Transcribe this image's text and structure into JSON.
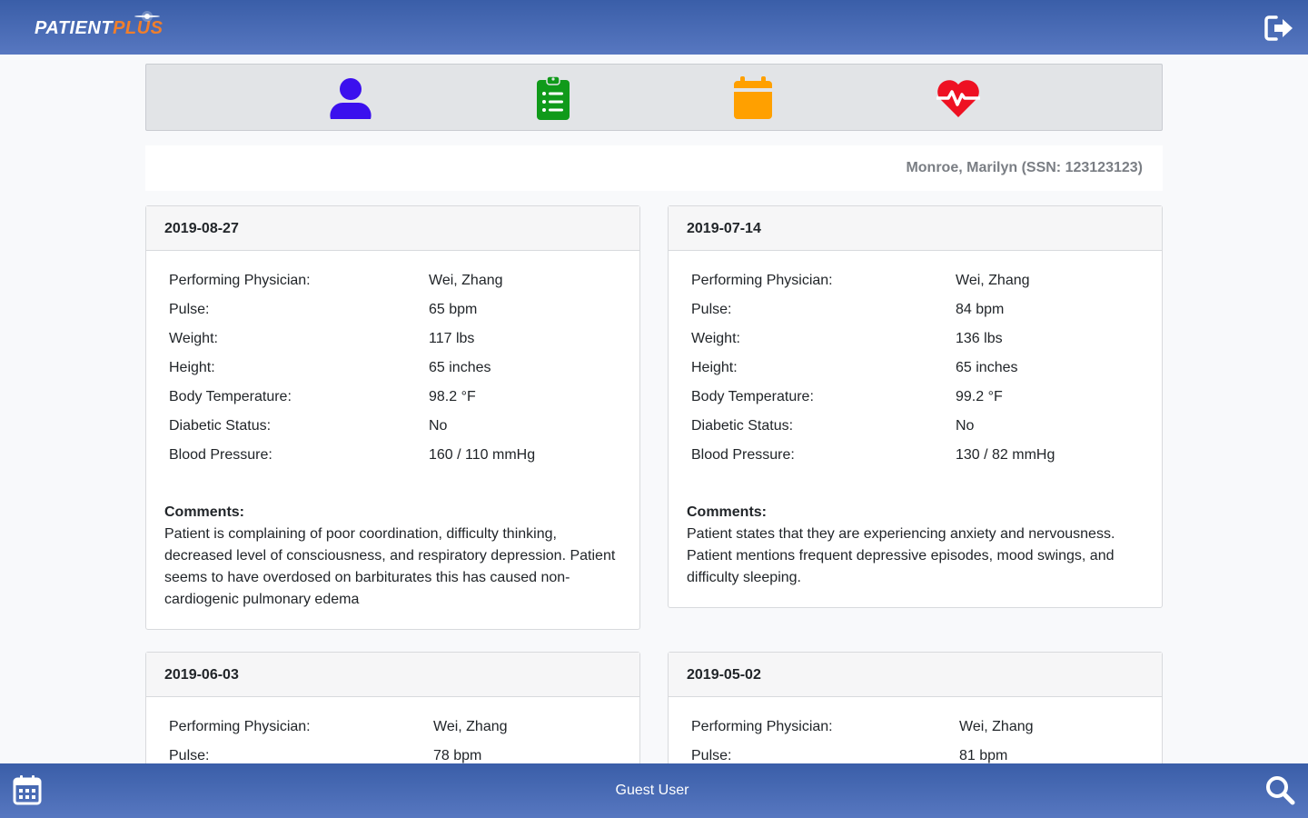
{
  "app": {
    "logo_part1": "PATIENT",
    "logo_part2": "PLUS",
    "brand_color": "#3a5ea8",
    "logo_accent": "#f07f2c"
  },
  "nav_icons": [
    {
      "icon": "user-icon",
      "color": "#3b10ee"
    },
    {
      "icon": "clipboard-list-icon",
      "color": "#109a1a"
    },
    {
      "icon": "calendar-icon",
      "color": "#ffa000"
    },
    {
      "icon": "heartbeat-icon",
      "color": "#ee1122"
    }
  ],
  "patient": {
    "display": "Monroe, Marilyn (SSN: 123123123)"
  },
  "labels": {
    "physician": "Performing Physician:",
    "pulse": "Pulse:",
    "weight": "Weight:",
    "height": "Height:",
    "temperature": "Body Temperature:",
    "diabetic": "Diabetic Status:",
    "bp": "Blood Pressure:",
    "comments": "Comments:"
  },
  "visits": [
    {
      "date": "2019-08-27",
      "physician": "Wei, Zhang",
      "pulse": "65 bpm",
      "weight": "117 lbs",
      "height": "65 inches",
      "temperature": "98.2 °F",
      "diabetic": "No",
      "bp": "160 / 110 mmHg",
      "comments": "Patient is complaining of poor coordination, difficulty thinking, decreased level of consciousness, and respiratory depression. Patient seems to have overdosed on barbiturates this has caused non-cardiogenic pulmonary edema"
    },
    {
      "date": "2019-07-14",
      "physician": "Wei, Zhang",
      "pulse": "84 bpm",
      "weight": "136 lbs",
      "height": "65 inches",
      "temperature": "99.2 °F",
      "diabetic": "No",
      "bp": "130 / 82 mmHg",
      "comments": "Patient states that they are experiencing anxiety and nervousness. Patient mentions frequent depressive episodes, mood swings, and difficulty sleeping."
    },
    {
      "date": "2019-06-03",
      "physician": "Wei, Zhang",
      "pulse": "78 bpm"
    },
    {
      "date": "2019-05-02",
      "physician": "Wei, Zhang",
      "pulse": "81 bpm"
    }
  ],
  "footer": {
    "user": "Guest User"
  }
}
